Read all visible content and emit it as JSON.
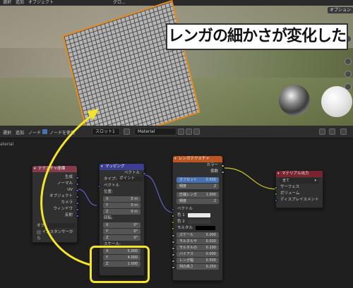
{
  "viewport": {
    "menu": [
      "選択",
      "追加",
      "オブジェクト"
    ],
    "mode_label": "グロ…",
    "overlay_tab": "オプション",
    "callout_text": "レンガの細かさが変化した"
  },
  "node_editor": {
    "header": {
      "menu": [
        "選択",
        "追加",
        "ノード"
      ],
      "use_nodes_label": "ノードを使用",
      "slot": "スロット1",
      "material": "Material"
    },
    "breadcrumb": "aterial",
    "texcoord": {
      "title": "テクスチャ座標",
      "outputs": [
        "生成",
        "ノーマル",
        "UV",
        "オブジェクト",
        "カメラ",
        "ウィンドウ",
        "反射"
      ],
      "object_label": "オブ",
      "instancer_label": "インスタンサーから"
    },
    "mapping": {
      "title": "マッピング",
      "vector_out": "ベクトル",
      "type_label": "タイプ:",
      "type_value": "ポイント",
      "vector_in": "ベクトル",
      "location_label": "位置:",
      "location": [
        {
          "axis": "X",
          "value": "0 m"
        },
        {
          "axis": "Y",
          "value": "0 m"
        },
        {
          "axis": "Z",
          "value": "0 m"
        }
      ],
      "rotation_label": "回転:",
      "rotation": [
        {
          "axis": "X",
          "value": "0°"
        },
        {
          "axis": "Y",
          "value": "0°"
        },
        {
          "axis": "Z",
          "value": "0°"
        }
      ],
      "scale_label": "スケール:",
      "scale": [
        {
          "axis": "X",
          "value": "5.000"
        },
        {
          "axis": "Y",
          "value": "4.000"
        },
        {
          "axis": "Z",
          "value": "1.000"
        }
      ]
    },
    "brick": {
      "title": "レンガテクスチャ",
      "outputs": [
        "カラー",
        "係数"
      ],
      "offset_label": "オフセット",
      "offset_value": "0.500",
      "frequency_label": "頻度",
      "frequency_value": "2",
      "squash_label": "圧縮レンガ",
      "squash_value": "1.000",
      "squash_freq_label": "頻度",
      "squash_freq_value": "2",
      "vector_in": "ベクトル",
      "color1_label": "色 1",
      "color2_label": "色 2",
      "mortar_label": "モルタル",
      "params": [
        {
          "label": "スケール",
          "value": "5.000"
        },
        {
          "label": "モルタルサ",
          "value": "0.020"
        },
        {
          "label": "モルタルの",
          "value": "0.100"
        },
        {
          "label": "バイアス",
          "value": "0.000"
        },
        {
          "label": "レンガ幅",
          "value": "0.500"
        },
        {
          "label": "列の高さ",
          "value": "0.250"
        }
      ]
    },
    "output": {
      "title": "マテリアル出力",
      "target": "全て",
      "inputs": [
        "サーフェス",
        "ボリューム",
        "ディスプレイスメント"
      ]
    },
    "colors": {
      "texcoord_header": "#833b4a",
      "mapping_header": "#3c3f91",
      "brick_header": "#bb5522",
      "output_header": "#7a2430",
      "highlight": "#f5e52a"
    }
  }
}
